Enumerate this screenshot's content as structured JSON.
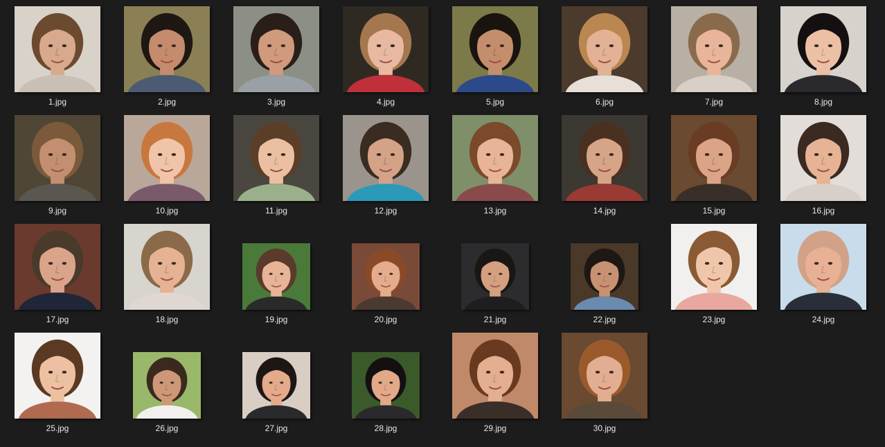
{
  "view": "thumbnail grid",
  "files": [
    {
      "name": "1.jpg",
      "size": "full",
      "bg": "#d9d2c8",
      "skin": "#d8a98c",
      "hair": "#6b4a30",
      "shirt": "#c9c0b5"
    },
    {
      "name": "2.jpg",
      "size": "full",
      "bg": "#8a7f55",
      "skin": "#c48c6c",
      "hair": "#1e1712",
      "shirt": "#4c5a73"
    },
    {
      "name": "3.jpg",
      "size": "full",
      "bg": "#8c8f86",
      "skin": "#d09a7c",
      "hair": "#2a1f18",
      "shirt": "#9aa0a6"
    },
    {
      "name": "4.jpg",
      "size": "full",
      "bg": "#2e2a22",
      "skin": "#e8b9a0",
      "hair": "#a5774e",
      "shirt": "#c0303a"
    },
    {
      "name": "5.jpg",
      "size": "full",
      "bg": "#7d7a4a",
      "skin": "#c48e6c",
      "hair": "#1a1410",
      "shirt": "#2c4a8a"
    },
    {
      "name": "6.jpg",
      "size": "full",
      "bg": "#4c3a2c",
      "skin": "#e3b193",
      "hair": "#b9874f",
      "shirt": "#e8e0d8"
    },
    {
      "name": "7.jpg",
      "size": "full",
      "bg": "#b8b0a4",
      "skin": "#e8b59b",
      "hair": "#8a6a4c",
      "shirt": "#d8cfc6"
    },
    {
      "name": "8.jpg",
      "size": "full",
      "bg": "#d8d2cc",
      "skin": "#ecc0a4",
      "hair": "#141012",
      "shirt": "#2a2a2e"
    },
    {
      "name": "9.jpg",
      "size": "full",
      "bg": "#4f4636",
      "skin": "#c29070",
      "hair": "#7a5a3a",
      "shirt": "#5a5650"
    },
    {
      "name": "10.jpg",
      "size": "full",
      "bg": "#b9a79a",
      "skin": "#f0c4a8",
      "hair": "#c8783e",
      "shirt": "#7a5a6a"
    },
    {
      "name": "11.jpg",
      "size": "full",
      "bg": "#4a4640",
      "skin": "#ebbfa2",
      "hair": "#5a3e28",
      "shirt": "#9ab08a"
    },
    {
      "name": "12.jpg",
      "size": "full",
      "bg": "#9a948c",
      "skin": "#d4a286",
      "hair": "#3a2c20",
      "shirt": "#2a9ab8"
    },
    {
      "name": "13.jpg",
      "size": "full",
      "bg": "#7f8f6a",
      "skin": "#e8b497",
      "hair": "#7a4a2a",
      "shirt": "#8a4a4a"
    },
    {
      "name": "14.jpg",
      "size": "full",
      "bg": "#3c3832",
      "skin": "#d6a486",
      "hair": "#4a3020",
      "shirt": "#9a3a34"
    },
    {
      "name": "15.jpg",
      "size": "full",
      "bg": "#6a4a30",
      "skin": "#dba487",
      "hair": "#6a3c24",
      "shirt": "#3a2e28"
    },
    {
      "name": "16.jpg",
      "size": "full",
      "bg": "#e2ddd8",
      "skin": "#e6b394",
      "hair": "#3a2a22",
      "shirt": "#d8d0c8"
    },
    {
      "name": "17.jpg",
      "size": "full",
      "bg": "#6a3a2e",
      "skin": "#d9a489",
      "hair": "#4a3a2c",
      "shirt": "#1e2638"
    },
    {
      "name": "18.jpg",
      "size": "full",
      "bg": "#d8d4ce",
      "skin": "#e5b293",
      "hair": "#8a6a48",
      "shirt": "#e0d8d0"
    },
    {
      "name": "19.jpg",
      "size": "small",
      "bg": "#4a7a3a",
      "skin": "#e6b497",
      "hair": "#5a3a2a",
      "shirt": "#2a2a2a"
    },
    {
      "name": "20.jpg",
      "size": "small",
      "bg": "#7a4a38",
      "skin": "#e4ac8c",
      "hair": "#8a4a28",
      "shirt": "#4a3a30"
    },
    {
      "name": "21.jpg",
      "size": "small",
      "bg": "#2c2c2e",
      "skin": "#d4a080",
      "hair": "#1a1614",
      "shirt": "#1e1e20"
    },
    {
      "name": "22.jpg",
      "size": "small",
      "bg": "#4a3828",
      "skin": "#c89272",
      "hair": "#1e1814",
      "shirt": "#6a8ab0"
    },
    {
      "name": "23.jpg",
      "size": "full",
      "bg": "#f2f0ee",
      "skin": "#f0c6aa",
      "hair": "#8a5a34",
      "shirt": "#e8a8a0"
    },
    {
      "name": "24.jpg",
      "size": "full",
      "bg": "#c8dcec",
      "skin": "#e8b094",
      "hair": "#d2a288",
      "shirt": "#2a2e38"
    },
    {
      "name": "25.jpg",
      "size": "full",
      "bg": "#f4f2f0",
      "skin": "#eec0a2",
      "hair": "#5a3a22",
      "shirt": "#b06a50"
    },
    {
      "name": "26.jpg",
      "size": "small",
      "bg": "#9ab86a",
      "skin": "#cc9878",
      "hair": "#3a2a1e",
      "shirt": "#f2f0ee"
    },
    {
      "name": "27.jpg",
      "size": "small",
      "bg": "#d8cec4",
      "skin": "#e4aa8a",
      "hair": "#1e1614",
      "shirt": "#2a2a2c"
    },
    {
      "name": "28.jpg",
      "size": "small",
      "bg": "#3a5a2a",
      "skin": "#e2a888",
      "hair": "#141012",
      "shirt": "#2a2a2e"
    },
    {
      "name": "29.jpg",
      "size": "full",
      "bg": "#c08a6a",
      "skin": "#e4ae90",
      "hair": "#6a3a20",
      "shirt": "#3a2e28"
    },
    {
      "name": "30.jpg",
      "size": "full",
      "bg": "#6a4a30",
      "skin": "#e2ae92",
      "hair": "#9a5a2c",
      "shirt": "#5a4a3a"
    }
  ]
}
